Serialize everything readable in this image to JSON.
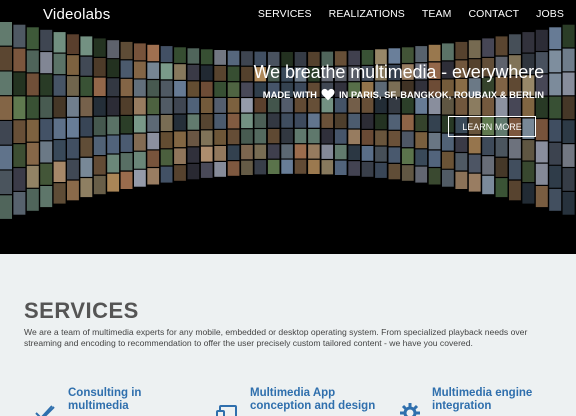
{
  "brand": {
    "logo": "Videolabs"
  },
  "nav": {
    "items": [
      "SERVICES",
      "REALIZATIONS",
      "TEAM",
      "CONTACT",
      "JOBS"
    ]
  },
  "hero": {
    "tagline": "We breathe multimedia - everywhere",
    "made_with_prefix": "MADE WITH",
    "made_with_suffix": "IN PARIS, SF, BANGKOK, ROUBAIX & BERLIN",
    "heart_icon": "heart-icon",
    "cta": "LEARN MORE"
  },
  "services": {
    "heading": "SERVICES",
    "intro": "We are a team of multimedia experts for any mobile, embedded or desktop operating system. From specialized playback needs over streaming and encoding to recommendation to offer the user precisely custom tailored content - we have you covered.",
    "cards": [
      {
        "title": "Consulting in multimedia",
        "icon": "checkmark-icon"
      },
      {
        "title": "Multimedia App conception and design",
        "icon": "devices-icon"
      },
      {
        "title": "Multimedia engine integration",
        "icon": "gear-icon"
      }
    ]
  },
  "colors": {
    "accent": "#2f6fad",
    "section_bg": "#edf1f2",
    "hero_bg": "#000000"
  }
}
